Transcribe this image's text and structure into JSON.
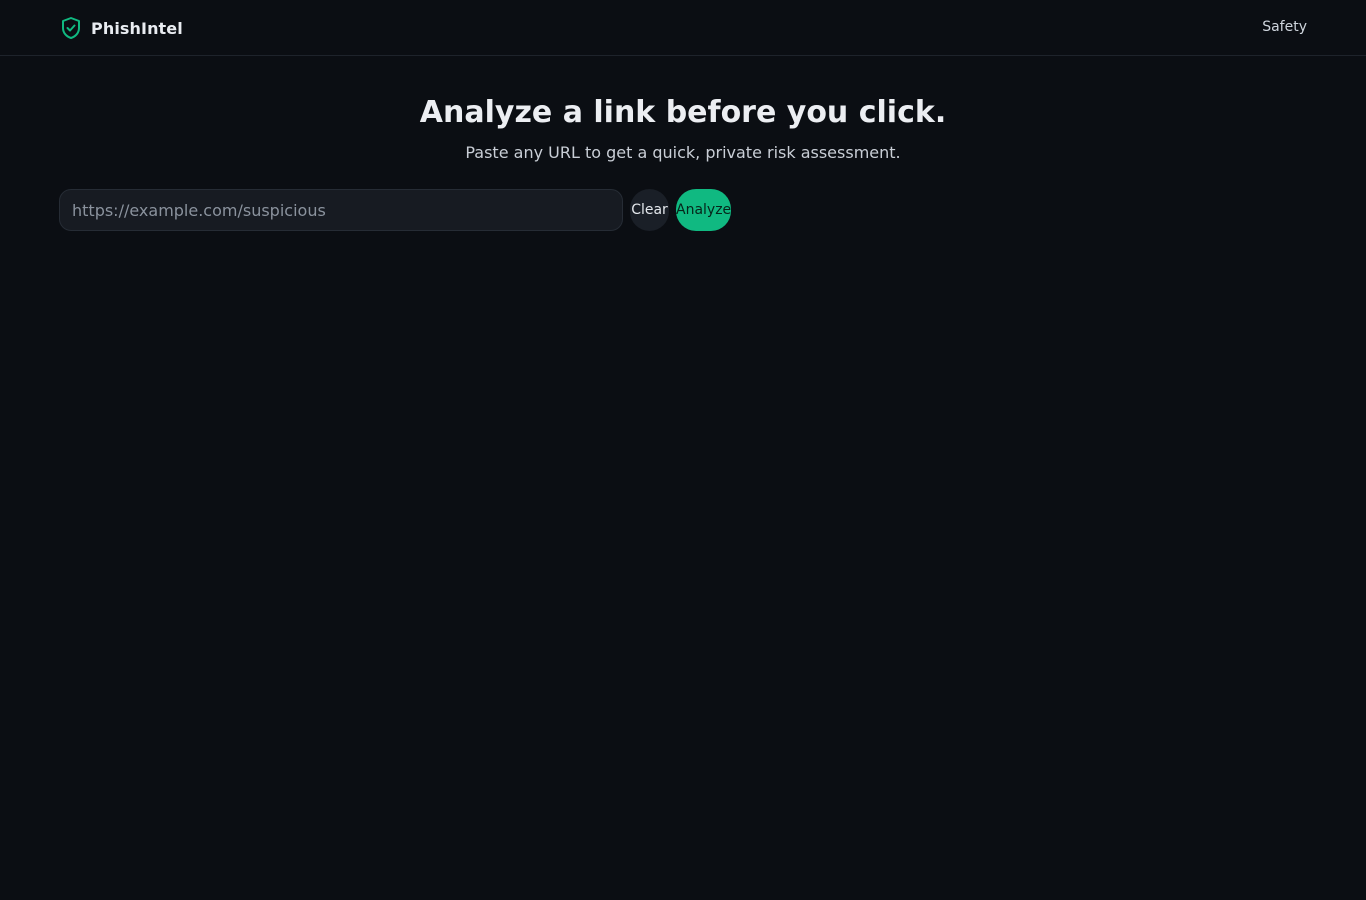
{
  "header": {
    "brand_name": "PhishIntel",
    "brand_icon": "shield-check-icon",
    "nav": [
      {
        "label": "Safety"
      }
    ]
  },
  "hero": {
    "title": "Analyze a link before you click.",
    "subtitle": "Paste any URL to get a quick, private risk assessment."
  },
  "search": {
    "value": "",
    "placeholder": "https://example.com/suspicious",
    "clear_label": "Clear",
    "analyze_label": "Analyze"
  },
  "colors": {
    "background": "#0b0e13",
    "accent": "#10b981",
    "input_bg": "#171b22"
  }
}
